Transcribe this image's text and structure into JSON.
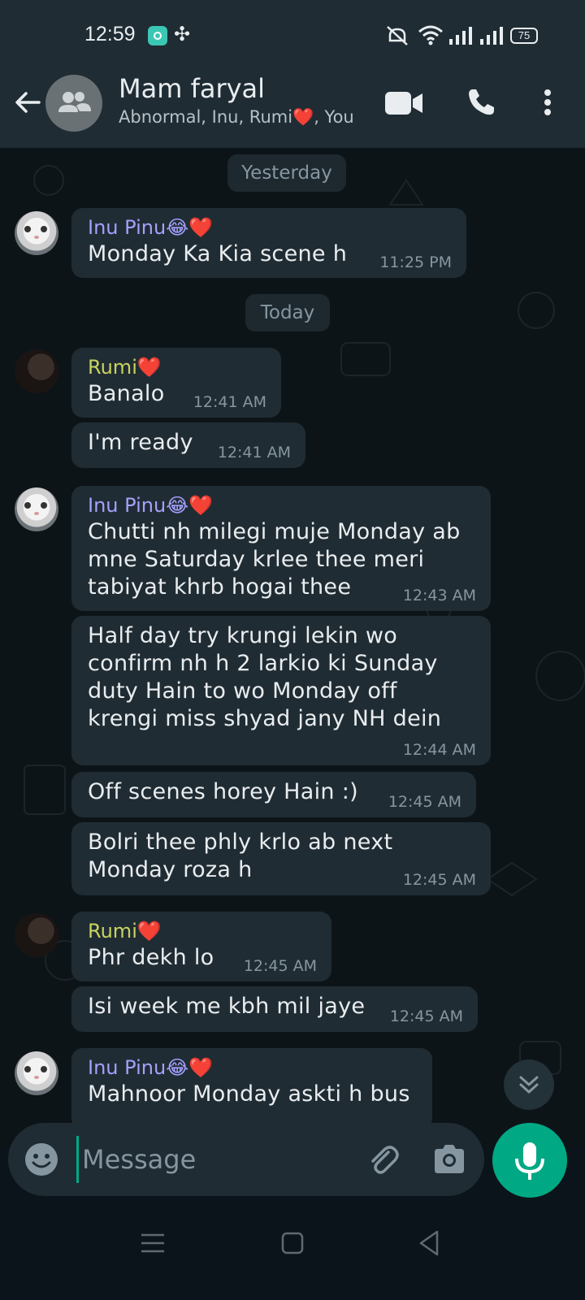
{
  "status_bar": {
    "time": "12:59",
    "battery": "75"
  },
  "header": {
    "title": "Mam faryal",
    "subtitle": "Abnormal, Inu, Rumi❤️, You",
    "back_icon": "arrow-left-icon",
    "video_icon": "video-camera-icon",
    "call_icon": "phone-icon",
    "more_icon": "more-vertical-icon"
  },
  "date_chips": {
    "yesterday": "Yesterday",
    "today": "Today"
  },
  "messages": [
    {
      "sender": "Inu Pinu😂❤️",
      "text": "Monday Ka Kia scene h",
      "time": "11:25 PM"
    },
    {
      "sender": "Rumi❤️",
      "text": "Banalo",
      "time": "12:41 AM"
    },
    {
      "sender": "",
      "text": "I'm ready",
      "time": "12:41 AM"
    },
    {
      "sender": "Inu Pinu😂❤️",
      "text": "Chutti nh milegi muje Monday ab mne Saturday krlee thee meri tabiyat khrb hogai thee",
      "time": "12:43 AM"
    },
    {
      "sender": "",
      "text": "Half day try krungi lekin wo confirm nh h 2 larkio ki Sunday duty Hain to wo Monday off krengi miss shyad jany NH dein",
      "time": "12:44 AM"
    },
    {
      "sender": "",
      "text": "Off scenes horey Hain :)",
      "time": "12:45 AM"
    },
    {
      "sender": "",
      "text": "Bolri thee phly krlo ab next Monday roza h",
      "time": "12:45 AM"
    },
    {
      "sender": "Rumi❤️",
      "text": "Phr dekh lo",
      "time": "12:45 AM"
    },
    {
      "sender": "",
      "text": "Isi week me kbh mil jaye",
      "time": "12:45 AM"
    },
    {
      "sender": "Inu Pinu😂❤️",
      "text": "Mahnoor Monday askti h bus",
      "time": ""
    }
  ],
  "composer": {
    "placeholder": "Message",
    "emoji_icon": "emoji-icon",
    "attach_icon": "paperclip-icon",
    "camera_icon": "camera-icon",
    "mic_icon": "microphone-icon"
  },
  "colors": {
    "accent": "#00a884",
    "bubble": "#202c33",
    "header": "#1f2c34",
    "sender_inu": "#a5a0ff",
    "sender_rumi": "#c9d35d"
  }
}
